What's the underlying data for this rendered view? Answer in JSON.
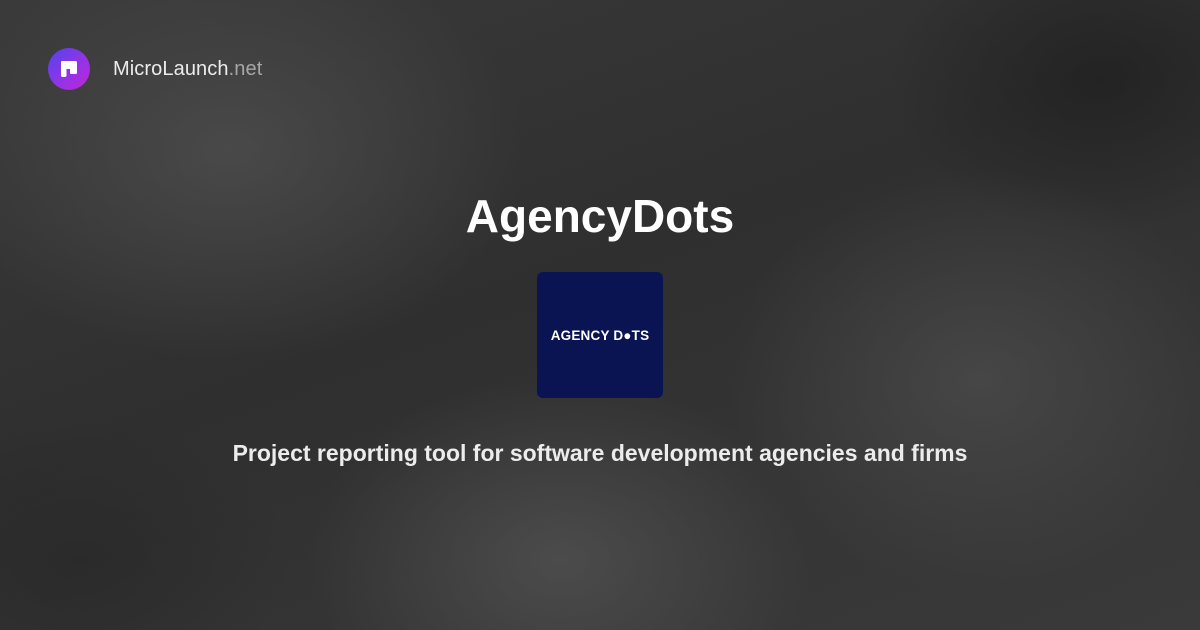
{
  "site": {
    "name": "MicroLaunch",
    "tld": ".net",
    "logo_icon": "microlaunch-logo-icon",
    "logo_gradient": [
      "#4f46e5",
      "#9333ea",
      "#c026d3"
    ]
  },
  "product": {
    "name": "AgencyDots",
    "logo_text": "AGENCY D●TS",
    "logo_bg": "#0a1453",
    "tagline": "Project reporting tool for software development agencies and firms"
  },
  "colors": {
    "background": "#333333",
    "title": "#ffffff",
    "tagline": "#ececec"
  }
}
